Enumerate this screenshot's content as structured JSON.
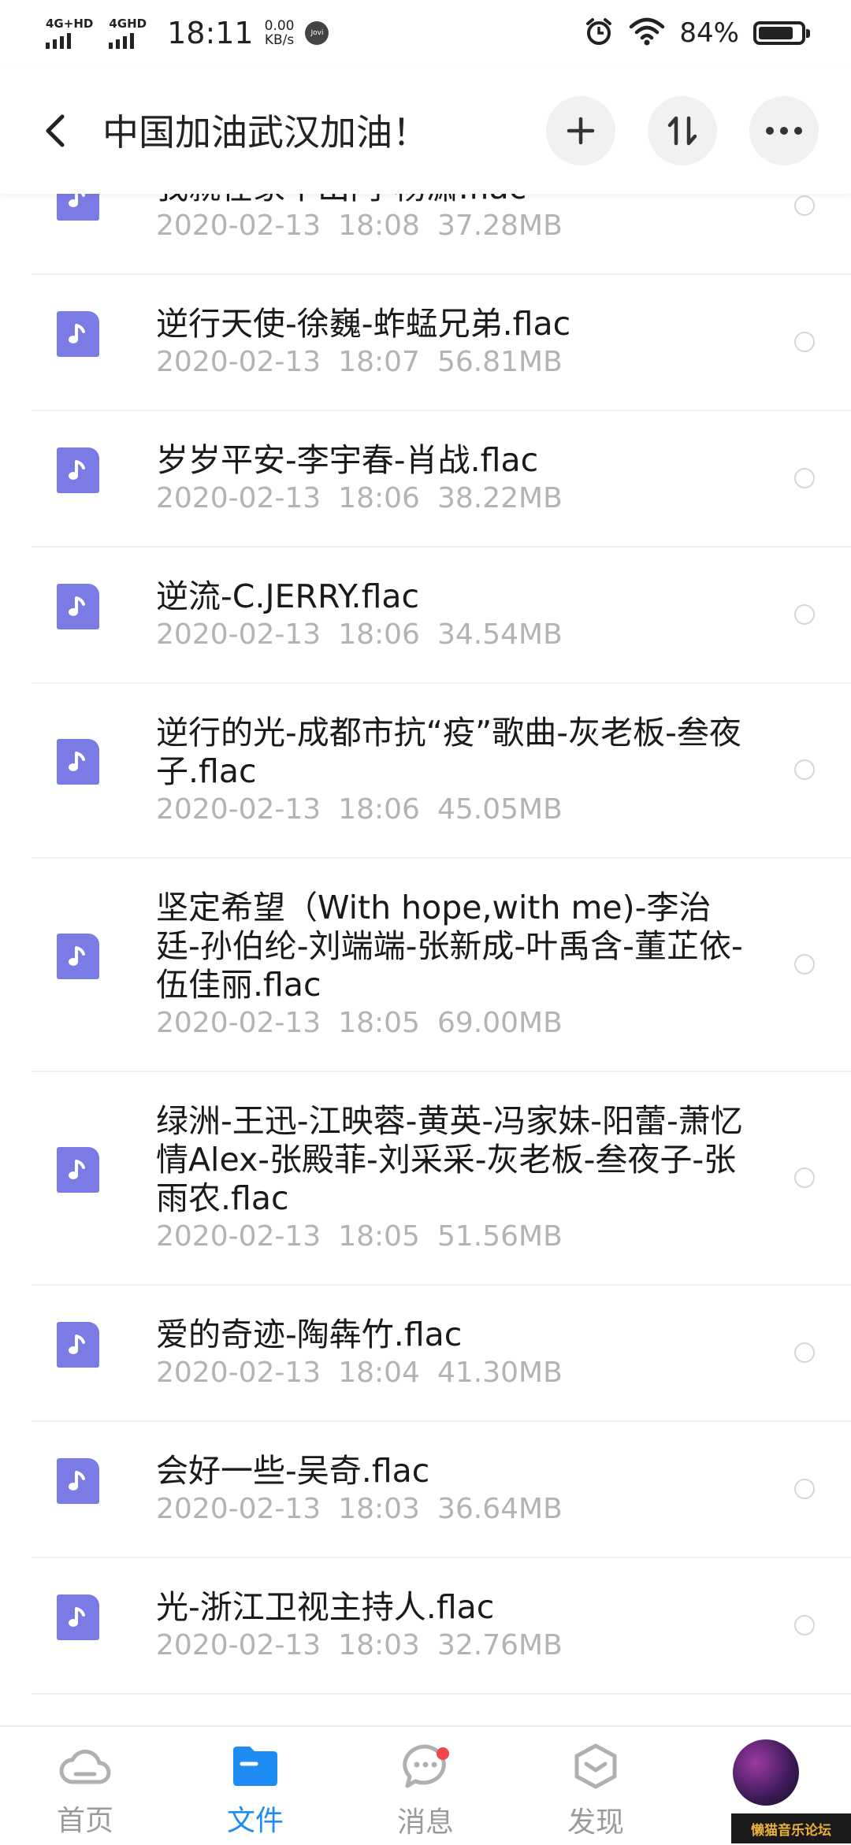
{
  "status_bar": {
    "network_1": "4G+HD",
    "network_2": "4GHD",
    "time": "18:11",
    "speed_value": "0.00",
    "speed_unit": "KB/s",
    "jovi": "Jovi",
    "battery": "84%",
    "battery_level": 0.84,
    "icons": [
      "alarm-icon",
      "wifi-icon",
      "battery-icon"
    ]
  },
  "header": {
    "title": "中国加油武汉加油！",
    "buttons": [
      "back-arrow-icon",
      "add-icon",
      "sort-icon",
      "more-icon"
    ]
  },
  "files": [
    {
      "name": "我就在家不出门-杨潇.flac",
      "date": "2020-02-13",
      "time": "18:08",
      "size": "37.28MB"
    },
    {
      "name": "逆行天使-徐巍-蚱蜢兄弟.flac",
      "date": "2020-02-13",
      "time": "18:07",
      "size": "56.81MB"
    },
    {
      "name": "岁岁平安-李宇春-肖战.flac",
      "date": "2020-02-13",
      "time": "18:06",
      "size": "38.22MB"
    },
    {
      "name": "逆流-C.JERRY.flac",
      "date": "2020-02-13",
      "time": "18:06",
      "size": "34.54MB"
    },
    {
      "name": "逆行的光-成都市抗“疫”歌曲-灰老板-叁夜子.flac",
      "date": "2020-02-13",
      "time": "18:06",
      "size": "45.05MB"
    },
    {
      "name": "坚定希望（With hope,with me)-李治廷-孙伯纶-刘端端-张新成-叶禹含-董芷依-伍佳丽.flac",
      "date": "2020-02-13",
      "time": "18:05",
      "size": "69.00MB"
    },
    {
      "name": "绿洲-王迅-江映蓉-黄英-冯家妹-阳蕾-萧忆情Alex-张殿菲-刘采采-灰老板-叁夜子-张雨农.flac",
      "date": "2020-02-13",
      "time": "18:05",
      "size": "51.56MB"
    },
    {
      "name": "爱的奇迹-陶犇竹.flac",
      "date": "2020-02-13",
      "time": "18:04",
      "size": "41.30MB"
    },
    {
      "name": "会好一些-吴奇.flac",
      "date": "2020-02-13",
      "time": "18:03",
      "size": "36.64MB"
    },
    {
      "name": "光-浙江卫视主持人.flac",
      "date": "2020-02-13",
      "time": "18:03",
      "size": "32.76MB"
    }
  ],
  "bottom_nav": [
    {
      "label": "首页",
      "icon": "cloud-icon",
      "active": false
    },
    {
      "label": "文件",
      "icon": "folder-icon",
      "active": true
    },
    {
      "label": "消息",
      "icon": "message-icon",
      "active": false,
      "badge": true
    },
    {
      "label": "发现",
      "icon": "discover-icon",
      "active": false
    }
  ],
  "watermark": "懒猫音乐论坛",
  "colors": {
    "accent": "#1e8cf3",
    "file_icon": "#7b7be6",
    "badge": "#f04848",
    "meta_text": "#b3b3b3"
  }
}
